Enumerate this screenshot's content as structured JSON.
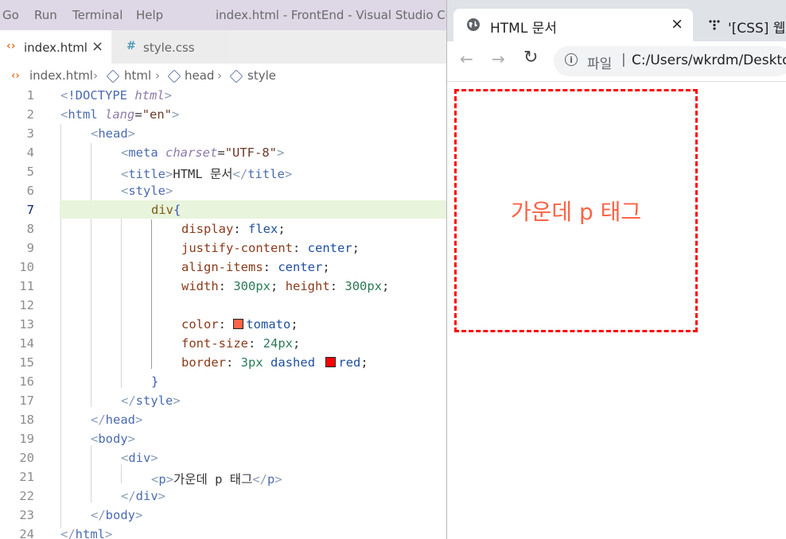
{
  "vscode": {
    "menu": [
      "Go",
      "Run",
      "Terminal",
      "Help"
    ],
    "window_title": "index.html - FrontEnd - Visual Studio Code",
    "tabs": [
      {
        "label": "index.html",
        "icon": "html-file-icon",
        "close": "×"
      },
      {
        "label": "style.css",
        "icon": "css-file-icon",
        "icon_glyph": "#"
      }
    ],
    "breadcrumb": [
      "index.html",
      "html",
      "head",
      "style"
    ],
    "line_numbers": [
      "1",
      "2",
      "3",
      "4",
      "5",
      "6",
      "7",
      "8",
      "9",
      "10",
      "11",
      "12",
      "13",
      "14",
      "15",
      "16",
      "17",
      "18",
      "19",
      "20",
      "21",
      "22",
      "23",
      "24"
    ],
    "active_line": 7,
    "code": {
      "doctype": "!DOCTYPE",
      "doctype_html": "html",
      "html": "html",
      "lang_attr": "lang",
      "lang_val": "\"en\"",
      "head": "head",
      "meta": "meta",
      "charset_attr": "charset",
      "charset_val": "\"UTF-8\"",
      "title": "title",
      "title_text": "HTML 문서",
      "style": "style",
      "selector": "div",
      "brace_open": "{",
      "brace_close": "}",
      "display_prop": "display",
      "display_val": "flex",
      "justify_prop": "justify-content",
      "justify_val": "center",
      "align_prop": "align-items",
      "align_val": "center",
      "width_prop": "width",
      "width_val": "300",
      "height_prop": "height",
      "height_val": "300",
      "unit_px": "px",
      "color_prop": "color",
      "color_val": "tomato",
      "font_size_prop": "font-size",
      "font_size_val": "24",
      "border_prop": "border",
      "border_width": "3",
      "border_style": "dashed",
      "border_color": "red",
      "body": "body",
      "div": "div",
      "p": "p",
      "p_text": "가운데 p 태그"
    },
    "swatch_colors": {
      "tomato": "#ff6347",
      "red": "#ff0000"
    }
  },
  "browser": {
    "active_tab_title": "HTML 문서",
    "active_tab_close": "×",
    "other_tab_title": "'[CSS] 웹",
    "omnibox_scheme": "파일",
    "omnibox_sep": "|",
    "omnibox_url": "C:/Users/wkrdm/Desktop",
    "nav": {
      "back": "←",
      "forward": "→",
      "reload": "↻"
    },
    "page_text": "가운데 p 태그"
  },
  "colors": {
    "menubar": "#ddd7e6",
    "active_line": "#e8f4dc",
    "accent_text": "#ff6347",
    "border": "#ff0000"
  }
}
